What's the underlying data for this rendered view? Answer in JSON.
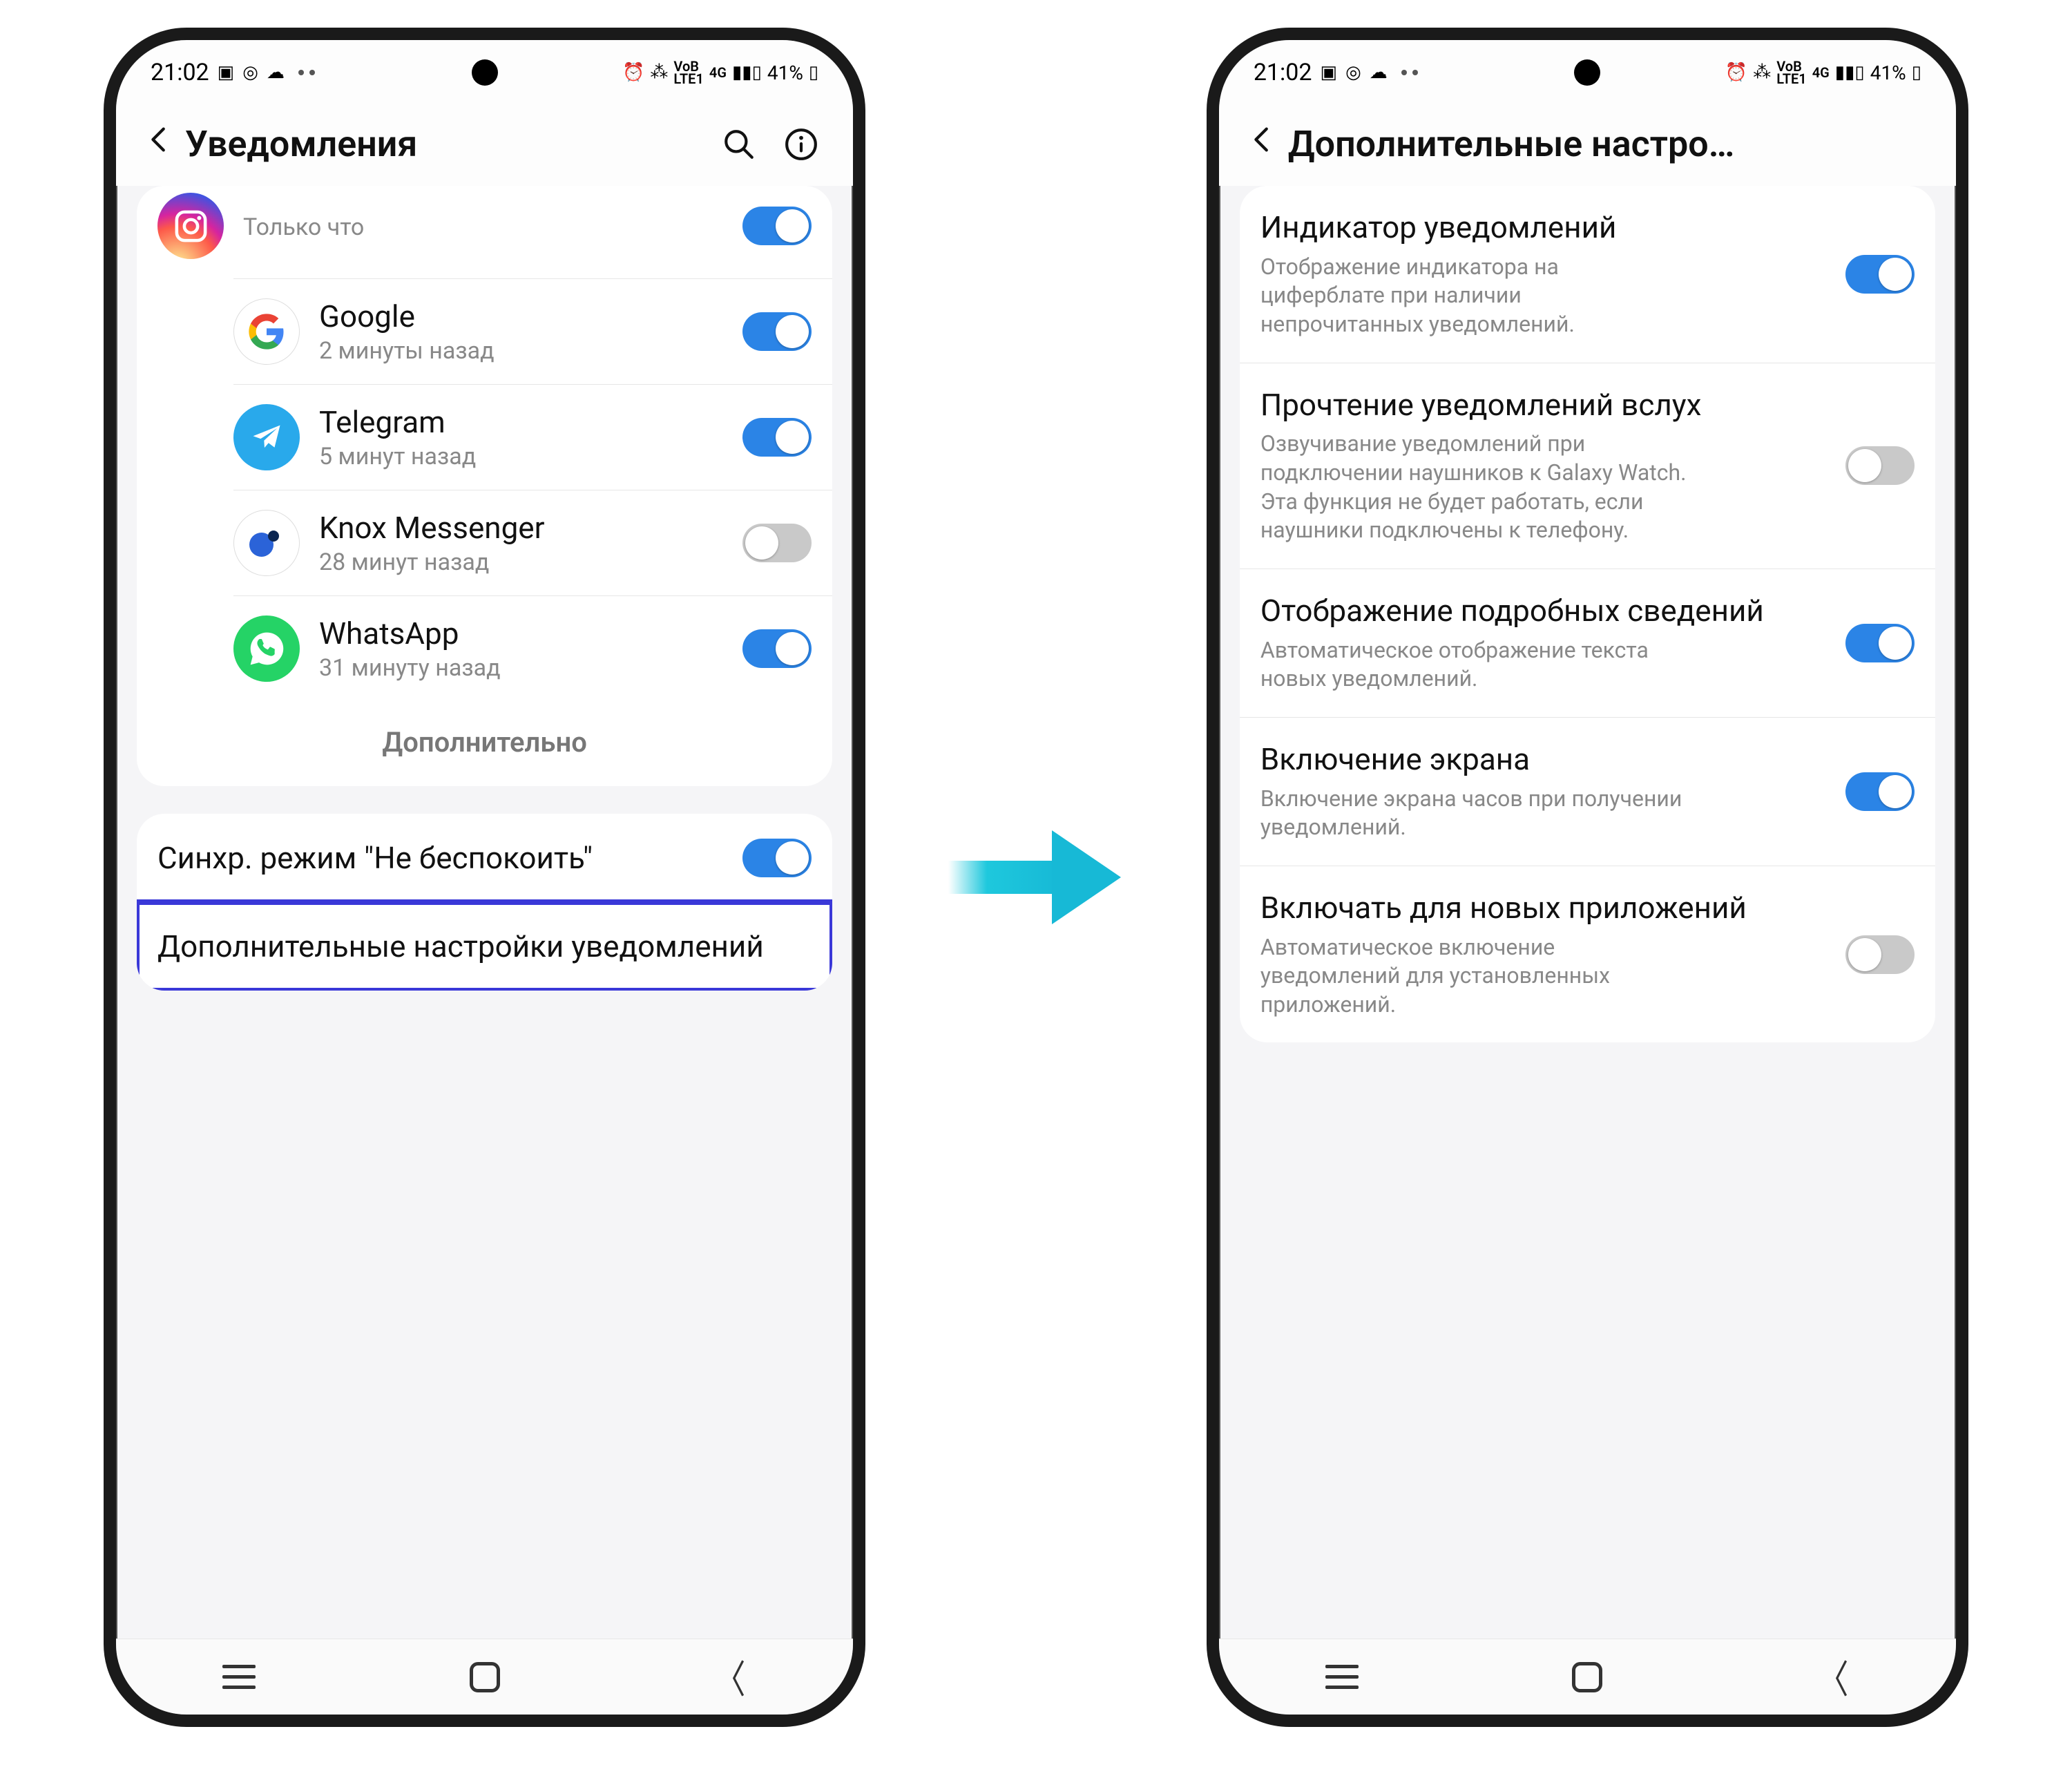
{
  "status": {
    "time": "21:02",
    "battery_text": "41%",
    "net_tiny1": "VoB",
    "net_tiny2": "LTE1",
    "net_tiny3": "4G"
  },
  "left": {
    "title": "Уведомления",
    "apps": [
      {
        "name": "Instagram",
        "sub": "Только что",
        "icon": "instagram",
        "on": true,
        "cut": true
      },
      {
        "name": "Google",
        "sub": "2 минуты назад",
        "icon": "google",
        "on": true
      },
      {
        "name": "Telegram",
        "sub": "5 минут назад",
        "icon": "telegram",
        "on": true
      },
      {
        "name": "Knox Messenger",
        "sub": "28 минут назад",
        "icon": "knox",
        "on": false
      },
      {
        "name": "WhatsApp",
        "sub": "31 минуту назад",
        "icon": "whatsapp",
        "on": true
      }
    ],
    "expand": "Дополнительно",
    "dnd_title": "Синхр. режим \"Не беспокоить\"",
    "dnd_on": true,
    "adv_title": "Дополнительные настройки уведомлений"
  },
  "right": {
    "title": "Дополнительные настро…",
    "settings": [
      {
        "title": "Индикатор уведомлений",
        "desc": "Отображение индикатора на циферблате при наличии непрочитанных уведомлений.",
        "on": true
      },
      {
        "title": "Прочтение уведомлений вслух",
        "desc": "Озвучивание уведомлений при подключении наушников к Galaxy Watch. Эта функция не будет работать, если наушники подключены к телефону.",
        "on": false
      },
      {
        "title": "Отображение подробных сведений",
        "desc": "Автоматическое отображение текста новых уведомлений.",
        "on": true
      },
      {
        "title": "Включение экрана",
        "desc": "Включение экрана часов при получении уведомлений.",
        "on": true
      },
      {
        "title": "Включать для новых приложений",
        "desc": "Автоматическое включение уведомлений для установленных приложений.",
        "on": false
      }
    ]
  }
}
